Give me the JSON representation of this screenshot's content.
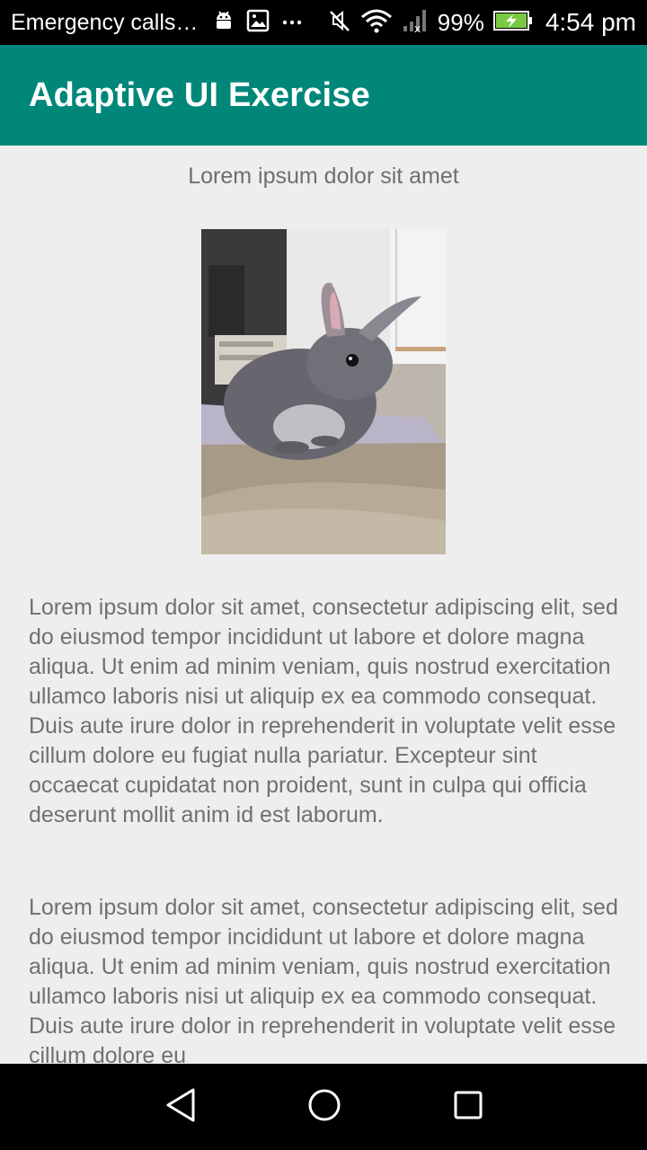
{
  "status_bar": {
    "carrier": "Emergency calls…",
    "battery_percent": "99%",
    "time": "4:54 pm",
    "icons": [
      "android-debug-icon",
      "image-icon",
      "more-icon",
      "mute-icon",
      "wifi-icon",
      "signal-icon",
      "battery-charging-icon"
    ]
  },
  "app_bar": {
    "title": "Adaptive UI Exercise",
    "color": "#00877a"
  },
  "content": {
    "headline": "Lorem ipsum dolor sit amet",
    "image_subject": "rabbit-photo",
    "paragraphs": [
      "Lorem ipsum dolor sit amet, consectetur adipiscing elit, sed do eiusmod tempor incididunt ut labore et dolore magna aliqua. Ut enim ad minim veniam, quis nostrud exercitation ullamco laboris nisi ut aliquip ex ea commodo consequat. Duis aute irure dolor in reprehenderit in voluptate velit esse cillum dolore eu fugiat nulla pariatur. Excepteur sint occaecat cupidatat non proident, sunt in culpa qui officia deserunt mollit anim id est laborum.",
      "Lorem ipsum dolor sit amet, consectetur adipiscing elit, sed do eiusmod tempor incididunt ut labore et dolore magna aliqua. Ut enim ad minim veniam, quis nostrud exercitation ullamco laboris nisi ut aliquip ex ea commodo consequat. Duis aute irure dolor in reprehenderit in voluptate velit esse cillum dolore eu"
    ]
  },
  "nav_bar": {
    "icons": [
      "back-icon",
      "home-icon",
      "recent-apps-icon"
    ]
  }
}
